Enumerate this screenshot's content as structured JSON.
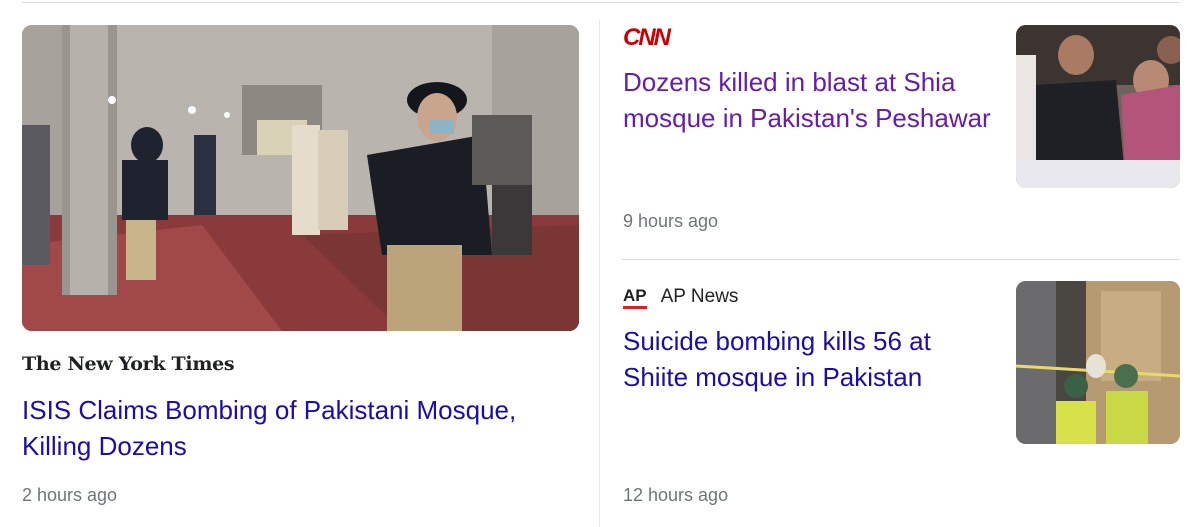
{
  "left_story": {
    "source": "The New York Times",
    "title": "ISIS Claims Bombing of Pakistani Mosque, Killing Dozens",
    "time": "2 hours ago",
    "image_icon": "news-photo"
  },
  "right_stories": [
    {
      "source": "CNN",
      "title": "Dozens killed in blast at Shia mosque in Pakistan's Peshawar",
      "time": "9 hours ago",
      "image_icon": "news-thumbnail"
    },
    {
      "source_logo": "AP",
      "source": "AP News",
      "title": "Suicide bombing kills 56 at Shiite mosque in Pakistan",
      "time": "12 hours ago",
      "image_icon": "news-thumbnail"
    }
  ],
  "colors": {
    "title_link": "#1a0dab",
    "visited_link": "#681da8",
    "meta_gray": "#70757a",
    "cnn_red": "#cc0000",
    "ap_red": "#e21f26"
  }
}
